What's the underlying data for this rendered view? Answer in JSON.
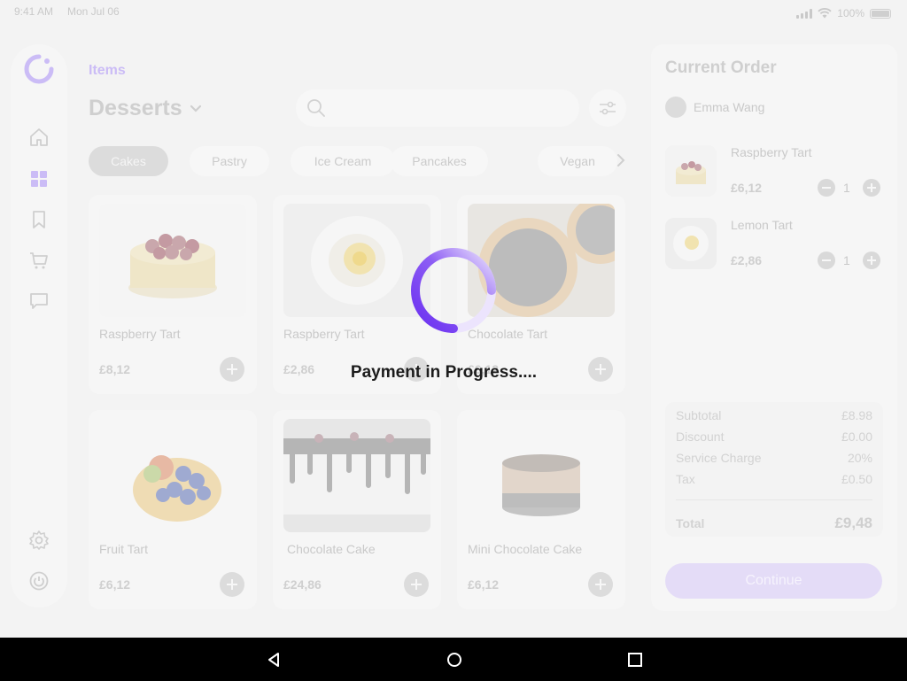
{
  "status_bar": {
    "time": "9:41 AM",
    "date": "Mon Jul 06",
    "battery": "100%"
  },
  "sidebar": {
    "items": [
      {
        "icon": "home-icon"
      },
      {
        "icon": "grid-icon"
      },
      {
        "icon": "bookmark-icon"
      },
      {
        "icon": "cart-icon"
      },
      {
        "icon": "chat-icon"
      },
      {
        "icon": "settings-icon"
      },
      {
        "icon": "power-icon"
      }
    ]
  },
  "main": {
    "breadcrumb": "Items",
    "title": "Desserts",
    "search": {
      "placeholder": ""
    },
    "categories": [
      "Cakes",
      "Pastry",
      "Ice Cream",
      "Pancakes",
      "Vegan"
    ],
    "active_category": "Cakes",
    "products": [
      {
        "name": "Raspberry Tart",
        "price": "£8,12"
      },
      {
        "name": "Raspberry Tart",
        "price": "£2,86"
      },
      {
        "name": "Chocolate Tart",
        "price": "£6,12"
      },
      {
        "name": "Fruit Tart",
        "price": "£6,12"
      },
      {
        "name": "Chocolate Cake",
        "price": "£24,86"
      },
      {
        "name": "Mini Chocolate Cake",
        "price": "£6,12"
      }
    ]
  },
  "order": {
    "title": "Current Order",
    "customer": "Emma Wang",
    "items": [
      {
        "name": "Raspberry Tart",
        "price": "£6,12",
        "qty": "1"
      },
      {
        "name": "Lemon Tart",
        "price": "£2,86",
        "qty": "1"
      }
    ],
    "summary": {
      "subtotal_label": "Subtotal",
      "subtotal": "£8.98",
      "discount_label": "Discount",
      "discount": "£0.00",
      "service_label": "Service Charge",
      "service": "20%",
      "tax_label": "Tax",
      "tax": "£0.50",
      "total_label": "Total",
      "total": "£9,48"
    },
    "continue_label": "Continue"
  },
  "overlay": {
    "message": "Payment in Progress...."
  },
  "colors": {
    "accent": "#7b3ff2",
    "accent_light": "#cbbcf6",
    "text_dark": "#1c1c1c"
  }
}
